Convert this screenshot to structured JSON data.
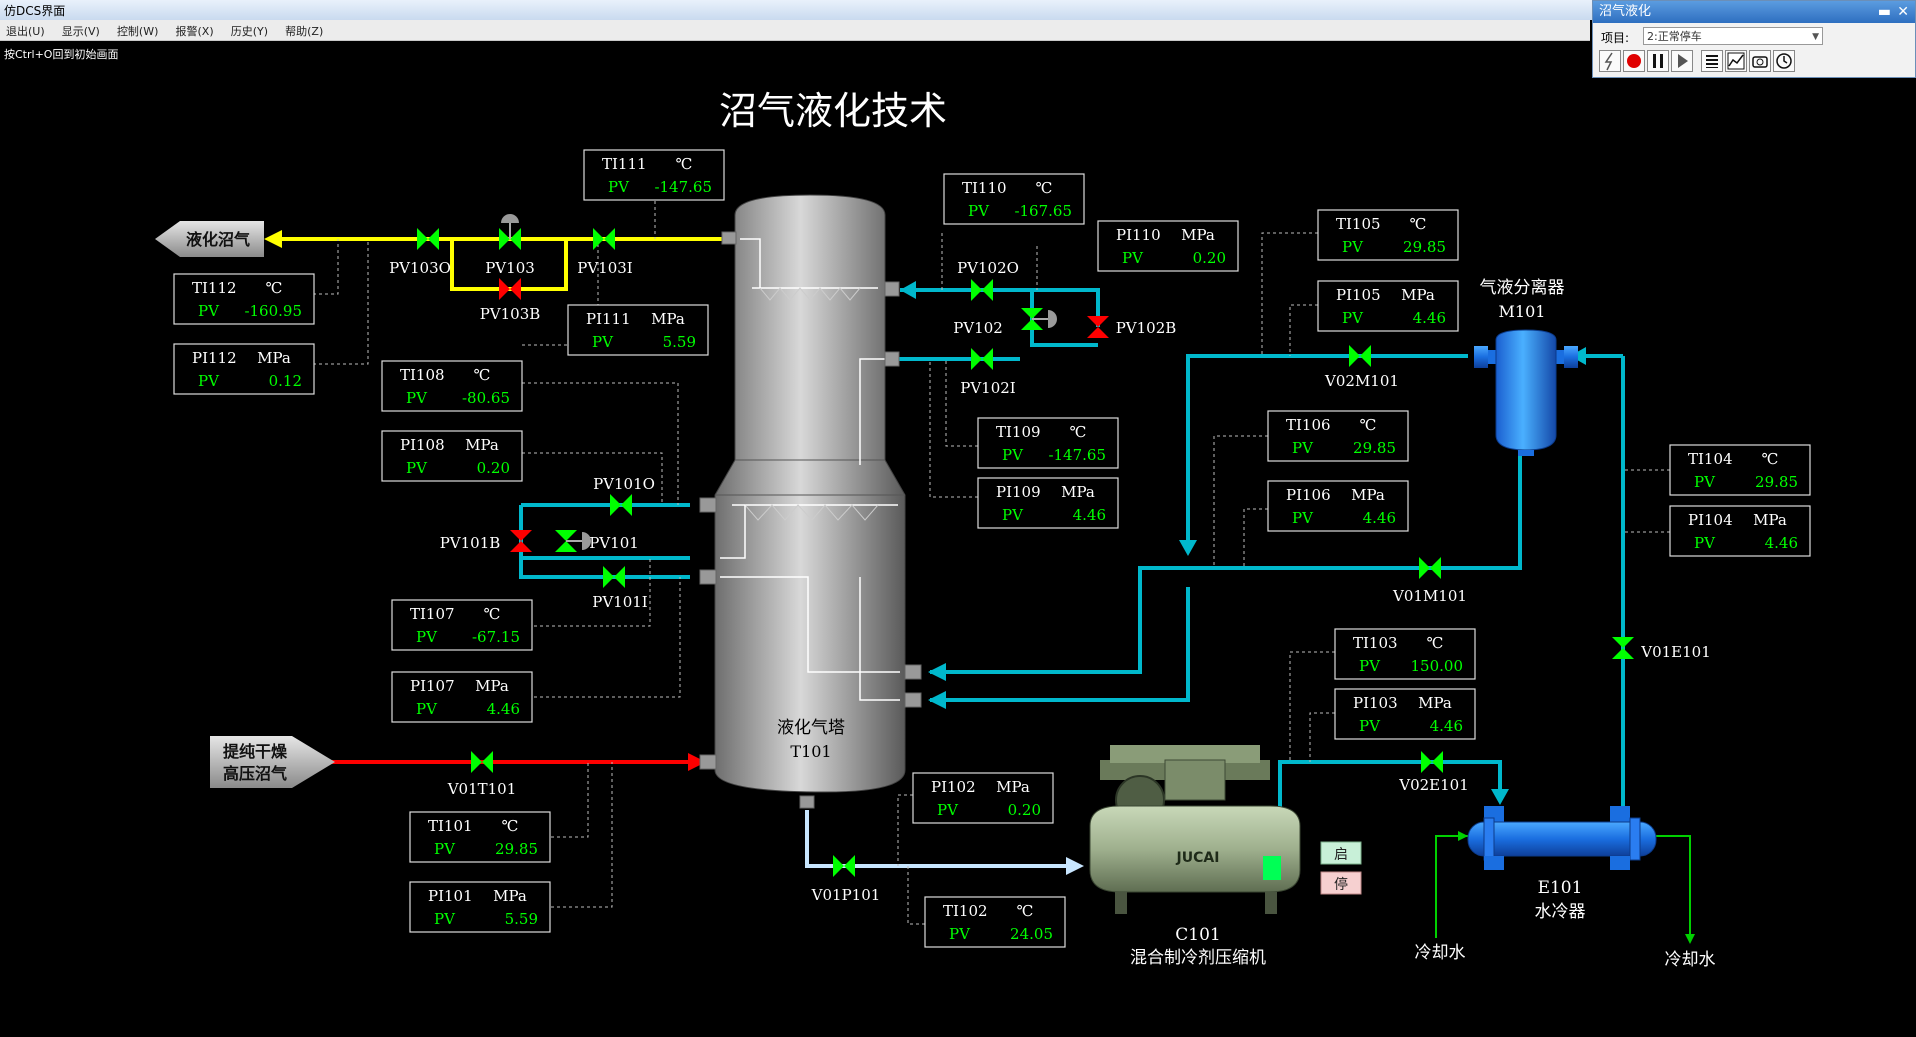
{
  "window": {
    "title": "仿DCS界面"
  },
  "menu": [
    {
      "label": "退出(U)"
    },
    {
      "label": "显示(V)"
    },
    {
      "label": "控制(W)"
    },
    {
      "label": "报警(X)"
    },
    {
      "label": "历史(Y)"
    },
    {
      "label": "帮助(Z)"
    }
  ],
  "hint": "按Ctrl+O回到初始画面",
  "panel": {
    "title": "沼气液化",
    "project_label": "项目:",
    "project_value": "2:正常停车",
    "minimize": "▬",
    "close": "✕"
  },
  "page_title": "沼气液化技术",
  "equipment": {
    "tower": {
      "line1": "液化气塔",
      "line2": "T101"
    },
    "separator": {
      "line1": "气液分离器",
      "line2": "M101"
    },
    "compressor": {
      "line1": "C101",
      "line2": "混合制冷剂压缩机",
      "brand": "JUCAI",
      "start": "启",
      "stop": "停"
    },
    "cooler": {
      "line1": "E101",
      "line2": "水冷器"
    },
    "cooling_water_in": "冷却水",
    "cooling_water_out": "冷却水",
    "product": "液化沼气",
    "feed_line1": "提纯干燥",
    "feed_line2": "高压沼气"
  },
  "valves": {
    "PV103O": "PV103O",
    "PV103": "PV103",
    "PV103B": "PV103B",
    "PV103I": "PV103I",
    "PV102O": "PV102O",
    "PV102": "PV102",
    "PV102B": "PV102B",
    "PV102I": "PV102I",
    "PV101O": "PV101O",
    "PV101": "PV101",
    "PV101B": "PV101B",
    "PV101I": "PV101I",
    "V01T101": "V01T101",
    "V01P101": "V01P101",
    "V02M101": "V02M101",
    "V01M101": "V01M101",
    "V01E101": "V01E101",
    "V02E101": "V02E101"
  },
  "pv_label": "PV",
  "instruments": [
    {
      "tag": "TI111",
      "unit": "℃",
      "value": "-147.65"
    },
    {
      "tag": "TI110",
      "unit": "℃",
      "value": "-167.65"
    },
    {
      "tag": "PI110",
      "unit": "MPa",
      "value": "0.20"
    },
    {
      "tag": "TI105",
      "unit": "℃",
      "value": "29.85"
    },
    {
      "tag": "PI105",
      "unit": "MPa",
      "value": "4.46"
    },
    {
      "tag": "TI112",
      "unit": "℃",
      "value": "-160.95"
    },
    {
      "tag": "PI111",
      "unit": "MPa",
      "value": "5.59"
    },
    {
      "tag": "PI112",
      "unit": "MPa",
      "value": "0.12"
    },
    {
      "tag": "TI108",
      "unit": "℃",
      "value": "-80.65"
    },
    {
      "tag": "PI108",
      "unit": "MPa",
      "value": "0.20"
    },
    {
      "tag": "TI109",
      "unit": "℃",
      "value": "-147.65"
    },
    {
      "tag": "PI109",
      "unit": "MPa",
      "value": "4.46"
    },
    {
      "tag": "TI106",
      "unit": "℃",
      "value": "29.85"
    },
    {
      "tag": "PI106",
      "unit": "MPa",
      "value": "4.46"
    },
    {
      "tag": "TI104",
      "unit": "℃",
      "value": "29.85"
    },
    {
      "tag": "PI104",
      "unit": "MPa",
      "value": "4.46"
    },
    {
      "tag": "TI107",
      "unit": "℃",
      "value": "-67.15"
    },
    {
      "tag": "PI107",
      "unit": "MPa",
      "value": "4.46"
    },
    {
      "tag": "TI103",
      "unit": "℃",
      "value": "150.00"
    },
    {
      "tag": "PI103",
      "unit": "MPa",
      "value": "4.46"
    },
    {
      "tag": "PI102",
      "unit": "MPa",
      "value": "0.20"
    },
    {
      "tag": "TI101",
      "unit": "℃",
      "value": "29.85"
    },
    {
      "tag": "PI101",
      "unit": "MPa",
      "value": "5.59"
    },
    {
      "tag": "TI102",
      "unit": "℃",
      "value": "24.05"
    }
  ],
  "colors": {
    "product_line": "#ffff00",
    "feed_line": "#ff0000",
    "refrigerant_line": "#00bcd4",
    "valve_open": "#00ff00",
    "valve_closed": "#ff0000",
    "pv_value": "#00ff00"
  }
}
